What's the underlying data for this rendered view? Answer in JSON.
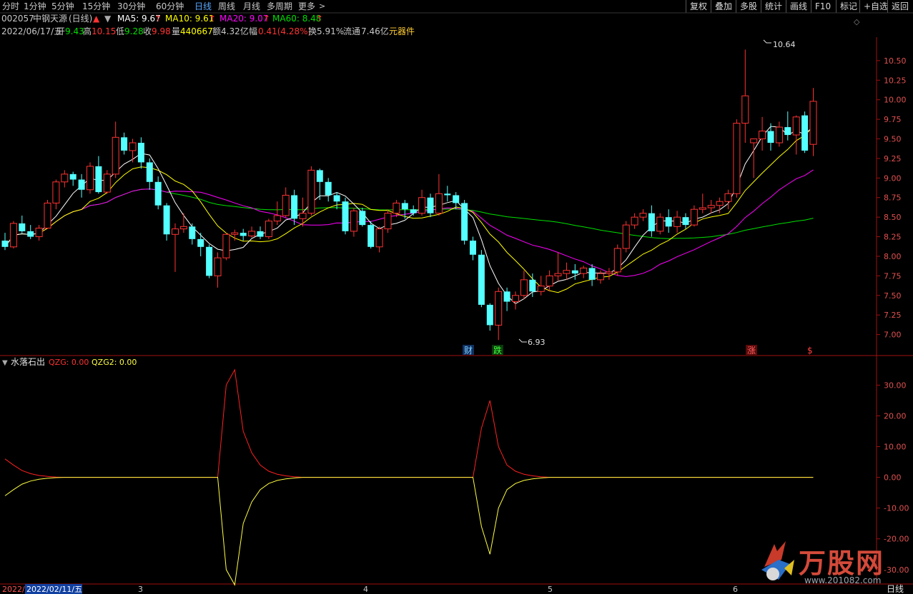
{
  "toolbar": {
    "left": [
      "分时",
      "1分钟",
      "5分钟",
      "15分钟",
      "30分钟",
      "60分钟",
      "日线",
      "周线",
      "月线",
      "多周期",
      "更多"
    ],
    "active": "日线",
    "right": [
      "复权",
      "叠加",
      "多股",
      "统计",
      "画线",
      "F10",
      "标记",
      "+自选",
      "返回"
    ],
    "more_arrow": ">"
  },
  "stock": {
    "code": "002057",
    "name": "中钢天源",
    "period": "(日线)",
    "date": "2022/06/17/五",
    "open_label": "开",
    "open": "9.43",
    "high_label": "高",
    "high": "10.15",
    "low_label": "低",
    "low": "9.28",
    "close_label": "收",
    "close": "9.98",
    "vol_label": "量",
    "vol": "440667",
    "amount_label": "额",
    "amount": "4.32亿",
    "change_label": "幅",
    "change": "0.41(4.28%)",
    "turnover_label": "换",
    "turnover": "5.91%",
    "float_label": "流通",
    "float_cap": "7.46亿",
    "concept": "元器件"
  },
  "ma_legend": {
    "ma5": "MA5: 9.67",
    "ma10": "MA10: 9.61",
    "ma20": "MA20: 9.07",
    "ma60": "MA60: 8.48",
    "up_arrow": "↑"
  },
  "indicator": {
    "name": "水落石出",
    "qzg": "QZG: 0.00",
    "qzg2": "QZG2: 0.00"
  },
  "colors": {
    "up": "#ff3333",
    "down": "#54ffff",
    "ma5": "#ffffff",
    "ma10": "#ffff00",
    "ma20": "#ff00ff",
    "ma60": "#00e000",
    "qzg": "#ff2020",
    "qzg2": "#ffff40",
    "frame": "#a01010"
  },
  "markers": {
    "cai": "财",
    "die": "跌",
    "zhang": "涨",
    "dollar": "$",
    "high_value": "10.64",
    "low_value": "6.93"
  },
  "date_axis": {
    "left_label": "2022/02/11/五",
    "cut_label": "2022/",
    "months": [
      "3",
      "4",
      "5",
      "6"
    ],
    "period_tag": "日线"
  },
  "watermark": {
    "main": "万股网",
    "sub": "www.201082.com"
  },
  "chart_data": [
    {
      "type": "candlestick",
      "ylim": [
        6.75,
        10.8
      ],
      "yticks": [
        7.0,
        7.25,
        7.5,
        7.75,
        8.0,
        8.25,
        8.5,
        8.75,
        9.0,
        9.25,
        9.5,
        9.75,
        10.0,
        10.25,
        10.5
      ],
      "ohlc": [
        [
          8.2,
          8.3,
          8.08,
          8.12
        ],
        [
          8.12,
          8.45,
          8.1,
          8.42
        ],
        [
          8.42,
          8.52,
          8.28,
          8.32
        ],
        [
          8.32,
          8.4,
          8.22,
          8.25
        ],
        [
          8.25,
          8.4,
          8.2,
          8.36
        ],
        [
          8.36,
          8.72,
          8.35,
          8.68
        ],
        [
          8.68,
          8.98,
          8.6,
          8.95
        ],
        [
          8.95,
          9.1,
          8.88,
          9.05
        ],
        [
          9.05,
          9.08,
          8.9,
          8.98
        ],
        [
          8.98,
          9.05,
          8.75,
          8.85
        ],
        [
          8.85,
          9.2,
          8.8,
          9.15
        ],
        [
          9.15,
          9.28,
          8.8,
          8.82
        ],
        [
          8.82,
          9.1,
          8.8,
          9.05
        ],
        [
          9.05,
          9.72,
          9.0,
          9.52
        ],
        [
          9.52,
          9.58,
          9.3,
          9.35
        ],
        [
          9.35,
          9.5,
          9.2,
          9.45
        ],
        [
          9.45,
          9.52,
          9.12,
          9.2
        ],
        [
          9.2,
          9.25,
          8.85,
          8.95
        ],
        [
          8.95,
          9.02,
          8.6,
          8.65
        ],
        [
          8.65,
          8.68,
          8.2,
          8.28
        ],
        [
          8.28,
          8.42,
          7.8,
          8.35
        ],
        [
          8.35,
          8.55,
          8.3,
          8.38
        ],
        [
          8.38,
          8.42,
          8.15,
          8.22
        ],
        [
          8.22,
          8.3,
          8.0,
          8.12
        ],
        [
          8.12,
          8.15,
          7.72,
          7.75
        ],
        [
          7.75,
          8.05,
          7.6,
          7.98
        ],
        [
          7.98,
          8.3,
          7.95,
          8.28
        ],
        [
          8.28,
          8.34,
          8.2,
          8.3
        ],
        [
          8.3,
          8.35,
          8.2,
          8.26
        ],
        [
          8.26,
          8.38,
          8.24,
          8.32
        ],
        [
          8.32,
          8.38,
          8.22,
          8.25
        ],
        [
          8.25,
          8.48,
          8.22,
          8.45
        ],
        [
          8.45,
          8.7,
          8.4,
          8.52
        ],
        [
          8.52,
          8.88,
          8.5,
          8.78
        ],
        [
          8.78,
          8.85,
          8.4,
          8.48
        ],
        [
          8.48,
          8.75,
          8.38,
          8.55
        ],
        [
          8.55,
          9.15,
          8.52,
          9.1
        ],
        [
          9.1,
          9.12,
          8.72,
          8.95
        ],
        [
          8.95,
          9.0,
          8.7,
          8.78
        ],
        [
          8.78,
          8.82,
          8.6,
          8.7
        ],
        [
          8.7,
          8.75,
          8.28,
          8.32
        ],
        [
          8.32,
          8.62,
          8.25,
          8.58
        ],
        [
          8.58,
          8.62,
          8.38,
          8.4
        ],
        [
          8.4,
          8.45,
          8.1,
          8.12
        ],
        [
          8.12,
          8.38,
          8.05,
          8.35
        ],
        [
          8.35,
          8.6,
          8.3,
          8.55
        ],
        [
          8.55,
          8.72,
          8.5,
          8.68
        ],
        [
          8.68,
          8.72,
          8.48,
          8.6
        ],
        [
          8.6,
          8.65,
          8.52,
          8.55
        ],
        [
          8.55,
          8.85,
          8.52,
          8.75
        ],
        [
          8.75,
          8.8,
          8.5,
          8.55
        ],
        [
          8.55,
          9.05,
          8.52,
          8.8
        ],
        [
          8.8,
          8.9,
          8.7,
          8.78
        ],
        [
          8.78,
          8.82,
          8.6,
          8.68
        ],
        [
          8.68,
          8.72,
          8.15,
          8.2
        ],
        [
          8.2,
          8.25,
          7.95,
          8.02
        ],
        [
          8.02,
          8.08,
          7.35,
          7.38
        ],
        [
          7.38,
          7.4,
          7.05,
          7.12
        ],
        [
          7.12,
          7.6,
          6.93,
          7.55
        ],
        [
          7.55,
          7.6,
          7.3,
          7.42
        ],
        [
          7.42,
          7.55,
          7.32,
          7.5
        ],
        [
          7.5,
          7.82,
          7.45,
          7.7
        ],
        [
          7.7,
          7.78,
          7.48,
          7.55
        ],
        [
          7.55,
          7.75,
          7.5,
          7.62
        ],
        [
          7.62,
          7.82,
          7.55,
          7.75
        ],
        [
          7.75,
          8.05,
          7.68,
          7.78
        ],
        [
          7.78,
          7.92,
          7.7,
          7.82
        ],
        [
          7.82,
          7.9,
          7.7,
          7.78
        ],
        [
          7.78,
          7.88,
          7.72,
          7.85
        ],
        [
          7.85,
          7.9,
          7.62,
          7.7
        ],
        [
          7.7,
          7.82,
          7.65,
          7.78
        ],
        [
          7.78,
          7.85,
          7.7,
          7.8
        ],
        [
          7.8,
          8.15,
          7.75,
          8.1
        ],
        [
          8.1,
          8.45,
          8.05,
          8.4
        ],
        [
          8.4,
          8.55,
          8.35,
          8.5
        ],
        [
          8.5,
          8.6,
          8.45,
          8.55
        ],
        [
          8.55,
          8.65,
          8.25,
          8.32
        ],
        [
          8.32,
          8.55,
          8.28,
          8.5
        ],
        [
          8.5,
          8.6,
          8.3,
          8.38
        ],
        [
          8.38,
          8.58,
          8.3,
          8.5
        ],
        [
          8.5,
          8.55,
          8.35,
          8.4
        ],
        [
          8.4,
          8.65,
          8.38,
          8.6
        ],
        [
          8.6,
          8.8,
          8.55,
          8.62
        ],
        [
          8.62,
          8.72,
          8.55,
          8.65
        ],
        [
          8.65,
          8.75,
          8.55,
          8.7
        ],
        [
          8.7,
          8.85,
          8.6,
          8.8
        ],
        [
          8.8,
          9.75,
          8.75,
          9.7
        ],
        [
          9.7,
          10.64,
          9.45,
          10.05
        ],
        [
          9.45,
          9.5,
          9.0,
          9.5
        ],
        [
          9.5,
          9.78,
          9.35,
          9.6
        ],
        [
          9.6,
          9.7,
          9.35,
          9.45
        ],
        [
          9.45,
          9.72,
          9.4,
          9.65
        ],
        [
          9.65,
          9.85,
          9.48,
          9.55
        ],
        [
          9.55,
          9.8,
          9.3,
          9.78
        ],
        [
          9.8,
          9.85,
          9.32,
          9.35
        ],
        [
          9.43,
          10.15,
          9.28,
          9.98
        ]
      ]
    },
    {
      "type": "line",
      "ylim": [
        -34,
        38
      ],
      "yticks": [
        30,
        20,
        10,
        0,
        -10,
        -20,
        -30
      ],
      "series": [
        {
          "name": "QZG",
          "values": [
            6,
            4,
            2.2,
            1.2,
            0.6,
            0.3,
            0.1,
            0,
            0,
            0,
            0,
            0,
            0,
            0,
            0,
            0,
            0,
            0,
            0,
            0,
            0,
            0,
            0,
            0,
            0,
            0,
            0,
            0,
            0,
            0,
            0,
            0,
            0,
            0,
            0,
            0,
            0,
            0,
            0,
            0,
            0,
            0,
            0,
            0,
            0,
            0,
            0,
            0,
            0,
            0,
            0,
            0,
            0,
            0,
            0,
            0,
            0,
            0,
            0,
            0,
            0,
            0,
            0,
            0,
            0,
            0,
            0,
            0,
            0,
            0,
            0,
            0,
            0,
            0,
            0,
            0,
            0,
            0,
            0,
            0,
            0,
            0,
            0,
            0,
            0,
            0,
            0,
            0,
            0,
            0,
            0,
            0,
            0,
            0,
            0,
            0
          ]
        },
        {
          "name": "QZG2",
          "values": [
            -6,
            -4,
            -2.2,
            -1.2,
            -0.6,
            -0.3,
            -0.1,
            0,
            0,
            0,
            0,
            0,
            0,
            0,
            0,
            0,
            0,
            0,
            0,
            0,
            0,
            0,
            0,
            0,
            0,
            0,
            0,
            0,
            0,
            0,
            0,
            0,
            0,
            0,
            0,
            0,
            0,
            0,
            0,
            0,
            0,
            0,
            0,
            0,
            0,
            0,
            0,
            0,
            0,
            0,
            0,
            0,
            0,
            0,
            0,
            0,
            0,
            0,
            0,
            0,
            0,
            0,
            0,
            0,
            0,
            0,
            0,
            0,
            0,
            0,
            0,
            0,
            0,
            0,
            0,
            0,
            0,
            0,
            0,
            0,
            0,
            0,
            0,
            0,
            0,
            0,
            0,
            0,
            0,
            0,
            0,
            0,
            0,
            0,
            0,
            0
          ]
        }
      ],
      "spikes": [
        {
          "start": 25,
          "values": [
            0,
            30,
            35,
            15,
            8,
            4,
            2,
            1,
            0.5,
            0.2,
            0
          ]
        },
        {
          "start": 55,
          "values": [
            0,
            16,
            25,
            10,
            4,
            2,
            1,
            0.5,
            0.2,
            0
          ]
        }
      ]
    }
  ]
}
